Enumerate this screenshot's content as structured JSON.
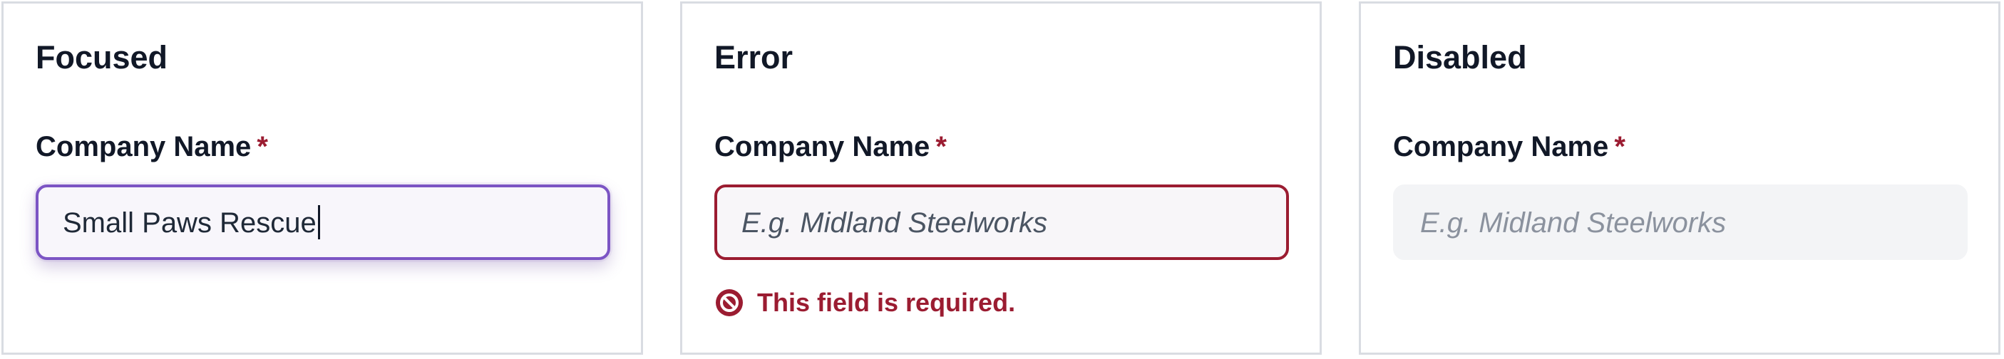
{
  "panels": [
    {
      "title": "Focused",
      "label": "Company Name",
      "required_mark": "*",
      "value": "Small Paws Rescue"
    },
    {
      "title": "Error",
      "label": "Company Name",
      "required_mark": "*",
      "placeholder": "E.g. Midland Steelworks",
      "error_message": "This field is required.",
      "error_icon": "error-circle-icon"
    },
    {
      "title": "Disabled",
      "label": "Company Name",
      "required_mark": "*",
      "placeholder": "E.g. Midland Steelworks"
    }
  ],
  "colors": {
    "focus_border": "#7c55c4",
    "error": "#9b1c31",
    "input_bg": "#f7f5fa",
    "disabled_bg": "#f3f4f6",
    "panel_border": "#d9dce2"
  }
}
